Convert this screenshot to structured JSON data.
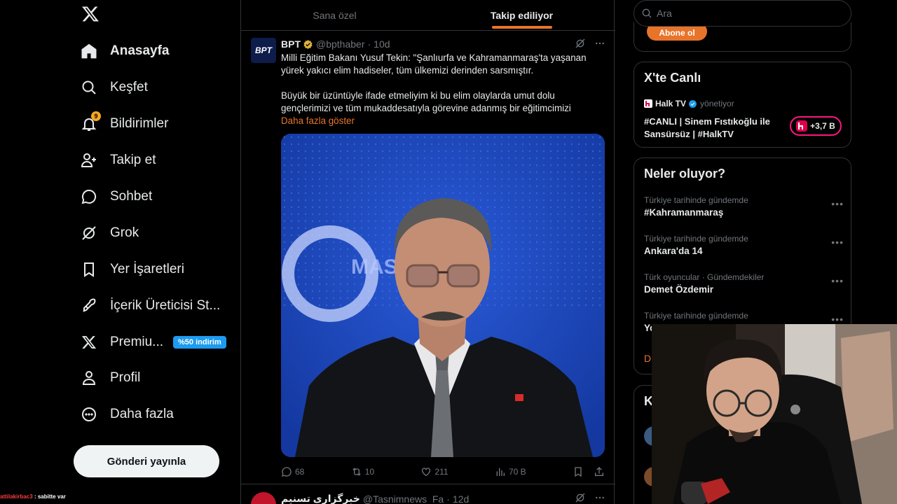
{
  "nav": {
    "items": [
      {
        "label": "Anasayfa",
        "icon": "home-icon",
        "active": true
      },
      {
        "label": "Keşfet",
        "icon": "search-icon"
      },
      {
        "label": "Bildirimler",
        "icon": "bell-icon",
        "badge": "9"
      },
      {
        "label": "Takip et",
        "icon": "person-add-icon"
      },
      {
        "label": "Sohbet",
        "icon": "chat-icon"
      },
      {
        "label": "Grok",
        "icon": "grok-icon"
      },
      {
        "label": "Yer İşaretleri",
        "icon": "bookmark-icon"
      },
      {
        "label": "İçerik Üreticisi St...",
        "icon": "rocket-icon"
      },
      {
        "label": "Premiu...",
        "icon": "x-icon",
        "promo": "%50 indirim"
      },
      {
        "label": "Profil",
        "icon": "person-icon"
      },
      {
        "label": "Daha fazla",
        "icon": "more-circle-icon"
      }
    ],
    "post_button": "Gönderi yayınla"
  },
  "chat_overlay": {
    "user": "attilakirbac3",
    "message": ": sabitte var"
  },
  "tabs": [
    {
      "label": "Sana özel",
      "active": false
    },
    {
      "label": "Takip ediliyor",
      "active": true
    }
  ],
  "post": {
    "avatar_text": "BPT",
    "name": "BPT",
    "handle": "@bpthaber",
    "sep": "·",
    "time": "10d",
    "text1": "Milli Eğitim Bakanı Yusuf Tekin: \"Şanlıurfa ve Kahramanmaraş'ta yaşanan yürek yakıcı elim hadiseler, tüm ülkemizi derinden sarsmıştır.",
    "text2": "Büyük bir üzüntüyle ifade etmeliyim ki bu elim olaylarda umut dolu gençlerimizi ve tüm mukaddesatıyla görevine adanmış bir eğitimcimizi",
    "show_more": "Daha fazla göster",
    "media_bg_text": "MASASI",
    "replies": "68",
    "reposts": "10",
    "likes": "211",
    "views": "70 B"
  },
  "post2": {
    "name": "خبرگزاری تسنیم",
    "handle": "@Tasnimnews_Fa",
    "sep": "·",
    "time": "12d"
  },
  "search": {
    "placeholder": "Ara"
  },
  "subscribe_button": "Abone ol",
  "live": {
    "title": "X'te Canlı",
    "host": "Halk TV",
    "host_suffix": "yönetiyor",
    "stream_title": "#CANLI | Sinem Fıstıkoğlu ile Sansürsüz | #HalkTV",
    "listeners": "+3,7 B"
  },
  "trends": {
    "title": "Neler oluyor?",
    "items": [
      {
        "context": "Türkiye tarihinde gündemde",
        "topic": "#Kahramanmaraş"
      },
      {
        "context": "Türkiye tarihinde gündemde",
        "topic": "Ankara'da 14"
      },
      {
        "context": "Türk oyuncular · Gündemdekiler",
        "topic": "Demet Özdemir"
      },
      {
        "context": "Türkiye tarihinde gündemde",
        "topic": "Yo"
      }
    ],
    "show_more_fragment": "D"
  },
  "who_to_follow_fragment": "K",
  "colors": {
    "accent": "#e8742a",
    "verified": "#e0b33b",
    "live": "#f91880",
    "promo": "#1d9bf0"
  }
}
